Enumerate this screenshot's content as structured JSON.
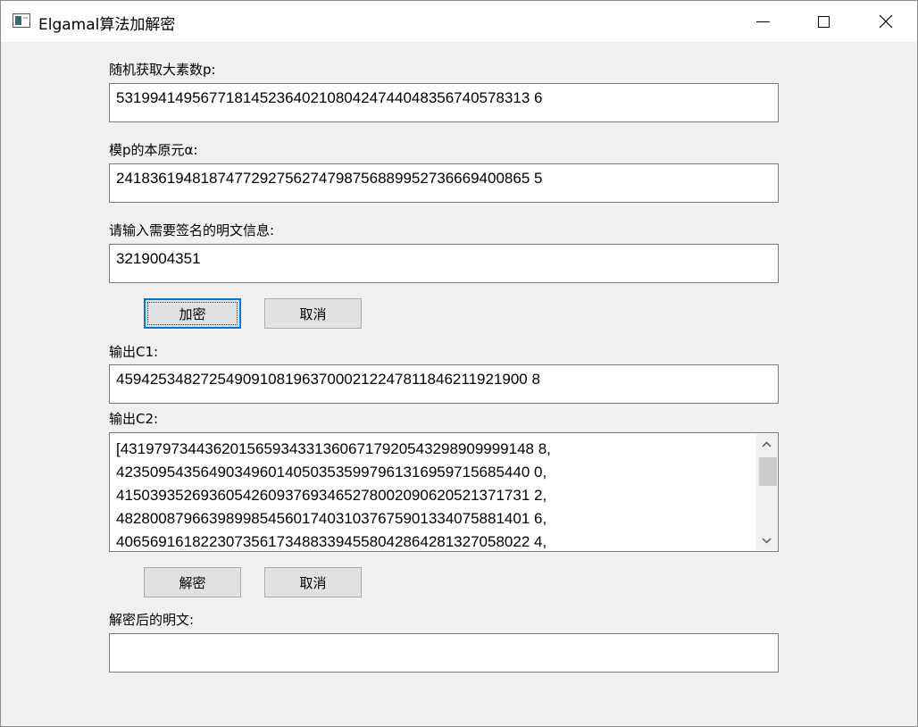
{
  "window": {
    "title": "Elgamal算法加解密"
  },
  "labels": {
    "prime": "随机获取大素数p:",
    "primitive_root": "模p的本原元α:",
    "message": "请输入需要签名的明文信息:",
    "c1": "输出C1:",
    "c2": "输出C2:",
    "plaintext": "解密后的明文:"
  },
  "fields": {
    "prime": "5319941495677181452364021080424744048356740578313 6",
    "primitive_root": "2418361948187477292756274798756889952736669400865 5",
    "message": "3219004351",
    "c1": "4594253482725490910819637000212247811846211921900 8",
    "plaintext": ""
  },
  "buttons": {
    "encrypt": "加密",
    "cancel1": "取消",
    "decrypt": "解密",
    "cancel2": "取消"
  },
  "c2_lines": [
    "[4319797344362015659343313606717920543298909999148 8,",
    "4235095435649034960140503535997961316959715685440 0,",
    "4150393526936054260937693465278002090620521371731 2,",
    "4828008796639899854560174031037675901334075881401 6,",
    "4065691618223073561734883394558042864281327058022 4,"
  ]
}
